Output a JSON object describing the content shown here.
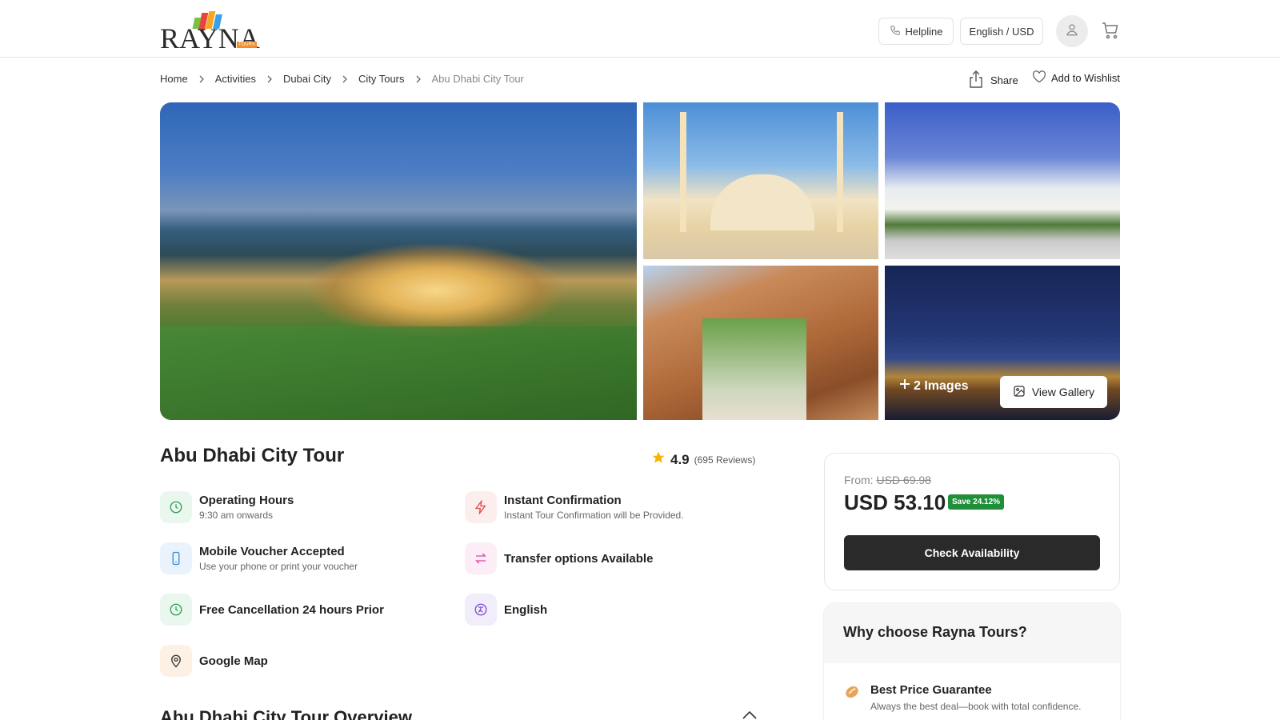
{
  "header": {
    "logo_text": "RAYNA",
    "logo_sub": "TOURS",
    "helpline_label": "Helpline",
    "language_currency_label": "English / USD"
  },
  "breadcrumb": [
    {
      "label": "Home"
    },
    {
      "label": "Activities"
    },
    {
      "label": "Dubai City"
    },
    {
      "label": "City Tours"
    },
    {
      "label": "Abu Dhabi City Tour"
    }
  ],
  "actions": {
    "share_label": "Share",
    "wishlist_label": "Add to Wishlist"
  },
  "gallery": {
    "more_images_label": "2 Images",
    "view_gallery_label": "View Gallery"
  },
  "tour": {
    "title": "Abu Dhabi City Tour",
    "rating": "4.9",
    "reviews": "(695 Reviews)"
  },
  "features": [
    {
      "title": "Operating Hours",
      "subtitle": "9:30 am onwards",
      "icon": "clock-icon",
      "color": "#2e9e57",
      "bg": "#eaf7ee"
    },
    {
      "title": "Instant Confirmation",
      "subtitle": "Instant Tour Confirmation will be Provided.",
      "icon": "lightning-icon",
      "color": "#e04b4b",
      "bg": "#fdeeee"
    },
    {
      "title": "Mobile Voucher Accepted",
      "subtitle": "Use your phone or print your voucher",
      "icon": "mobile-icon",
      "color": "#3a8ad6",
      "bg": "#eaf3fc"
    },
    {
      "title": "Transfer options Available",
      "subtitle": "",
      "icon": "transfer-icon",
      "color": "#d94aa0",
      "bg": "#fcedf6"
    },
    {
      "title": "Free Cancellation 24 hours Prior",
      "subtitle": "",
      "icon": "clock-icon",
      "color": "#2e9e57",
      "bg": "#eaf7ee"
    },
    {
      "title": "English",
      "subtitle": "",
      "icon": "language-icon",
      "color": "#7b4fd0",
      "bg": "#f2edfb"
    },
    {
      "title": "Google Map",
      "subtitle": "",
      "icon": "map-pin-icon",
      "color": "#333333",
      "bg": "#fdf1e6"
    }
  ],
  "overview": {
    "title": "Abu Dhabi City Tour Overview"
  },
  "price": {
    "from_label": "From:",
    "old_price": "USD 69.98",
    "price": "USD 53.10",
    "save_label": "Save 24.12%",
    "cta_label": "Check Availability"
  },
  "why_choose": {
    "title": "Why choose Rayna Tours?",
    "items": [
      {
        "title": "Best Price Guarantee",
        "subtitle": "Always the best deal—book with total confidence.",
        "icon": "price-tag-icon"
      }
    ]
  },
  "colors": {
    "save_green": "#1f8f3a",
    "cta_dark": "#2a2a2a"
  }
}
